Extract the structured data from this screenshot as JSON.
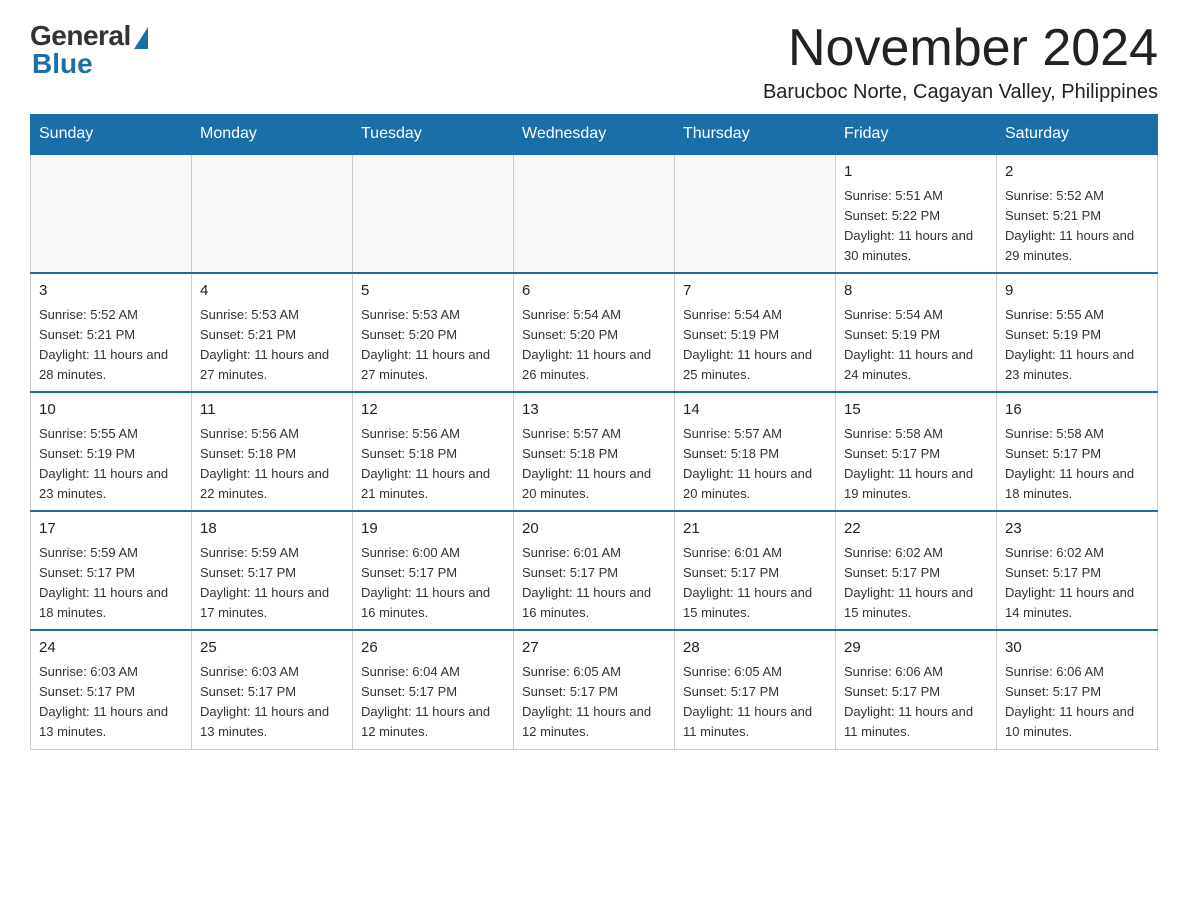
{
  "logo": {
    "general": "General",
    "blue": "Blue"
  },
  "title": "November 2024",
  "location": "Barucboc Norte, Cagayan Valley, Philippines",
  "weekdays": [
    "Sunday",
    "Monday",
    "Tuesday",
    "Wednesday",
    "Thursday",
    "Friday",
    "Saturday"
  ],
  "weeks": [
    [
      {
        "day": "",
        "info": ""
      },
      {
        "day": "",
        "info": ""
      },
      {
        "day": "",
        "info": ""
      },
      {
        "day": "",
        "info": ""
      },
      {
        "day": "",
        "info": ""
      },
      {
        "day": "1",
        "info": "Sunrise: 5:51 AM\nSunset: 5:22 PM\nDaylight: 11 hours and 30 minutes."
      },
      {
        "day": "2",
        "info": "Sunrise: 5:52 AM\nSunset: 5:21 PM\nDaylight: 11 hours and 29 minutes."
      }
    ],
    [
      {
        "day": "3",
        "info": "Sunrise: 5:52 AM\nSunset: 5:21 PM\nDaylight: 11 hours and 28 minutes."
      },
      {
        "day": "4",
        "info": "Sunrise: 5:53 AM\nSunset: 5:21 PM\nDaylight: 11 hours and 27 minutes."
      },
      {
        "day": "5",
        "info": "Sunrise: 5:53 AM\nSunset: 5:20 PM\nDaylight: 11 hours and 27 minutes."
      },
      {
        "day": "6",
        "info": "Sunrise: 5:54 AM\nSunset: 5:20 PM\nDaylight: 11 hours and 26 minutes."
      },
      {
        "day": "7",
        "info": "Sunrise: 5:54 AM\nSunset: 5:19 PM\nDaylight: 11 hours and 25 minutes."
      },
      {
        "day": "8",
        "info": "Sunrise: 5:54 AM\nSunset: 5:19 PM\nDaylight: 11 hours and 24 minutes."
      },
      {
        "day": "9",
        "info": "Sunrise: 5:55 AM\nSunset: 5:19 PM\nDaylight: 11 hours and 23 minutes."
      }
    ],
    [
      {
        "day": "10",
        "info": "Sunrise: 5:55 AM\nSunset: 5:19 PM\nDaylight: 11 hours and 23 minutes."
      },
      {
        "day": "11",
        "info": "Sunrise: 5:56 AM\nSunset: 5:18 PM\nDaylight: 11 hours and 22 minutes."
      },
      {
        "day": "12",
        "info": "Sunrise: 5:56 AM\nSunset: 5:18 PM\nDaylight: 11 hours and 21 minutes."
      },
      {
        "day": "13",
        "info": "Sunrise: 5:57 AM\nSunset: 5:18 PM\nDaylight: 11 hours and 20 minutes."
      },
      {
        "day": "14",
        "info": "Sunrise: 5:57 AM\nSunset: 5:18 PM\nDaylight: 11 hours and 20 minutes."
      },
      {
        "day": "15",
        "info": "Sunrise: 5:58 AM\nSunset: 5:17 PM\nDaylight: 11 hours and 19 minutes."
      },
      {
        "day": "16",
        "info": "Sunrise: 5:58 AM\nSunset: 5:17 PM\nDaylight: 11 hours and 18 minutes."
      }
    ],
    [
      {
        "day": "17",
        "info": "Sunrise: 5:59 AM\nSunset: 5:17 PM\nDaylight: 11 hours and 18 minutes."
      },
      {
        "day": "18",
        "info": "Sunrise: 5:59 AM\nSunset: 5:17 PM\nDaylight: 11 hours and 17 minutes."
      },
      {
        "day": "19",
        "info": "Sunrise: 6:00 AM\nSunset: 5:17 PM\nDaylight: 11 hours and 16 minutes."
      },
      {
        "day": "20",
        "info": "Sunrise: 6:01 AM\nSunset: 5:17 PM\nDaylight: 11 hours and 16 minutes."
      },
      {
        "day": "21",
        "info": "Sunrise: 6:01 AM\nSunset: 5:17 PM\nDaylight: 11 hours and 15 minutes."
      },
      {
        "day": "22",
        "info": "Sunrise: 6:02 AM\nSunset: 5:17 PM\nDaylight: 11 hours and 15 minutes."
      },
      {
        "day": "23",
        "info": "Sunrise: 6:02 AM\nSunset: 5:17 PM\nDaylight: 11 hours and 14 minutes."
      }
    ],
    [
      {
        "day": "24",
        "info": "Sunrise: 6:03 AM\nSunset: 5:17 PM\nDaylight: 11 hours and 13 minutes."
      },
      {
        "day": "25",
        "info": "Sunrise: 6:03 AM\nSunset: 5:17 PM\nDaylight: 11 hours and 13 minutes."
      },
      {
        "day": "26",
        "info": "Sunrise: 6:04 AM\nSunset: 5:17 PM\nDaylight: 11 hours and 12 minutes."
      },
      {
        "day": "27",
        "info": "Sunrise: 6:05 AM\nSunset: 5:17 PM\nDaylight: 11 hours and 12 minutes."
      },
      {
        "day": "28",
        "info": "Sunrise: 6:05 AM\nSunset: 5:17 PM\nDaylight: 11 hours and 11 minutes."
      },
      {
        "day": "29",
        "info": "Sunrise: 6:06 AM\nSunset: 5:17 PM\nDaylight: 11 hours and 11 minutes."
      },
      {
        "day": "30",
        "info": "Sunrise: 6:06 AM\nSunset: 5:17 PM\nDaylight: 11 hours and 10 minutes."
      }
    ]
  ]
}
